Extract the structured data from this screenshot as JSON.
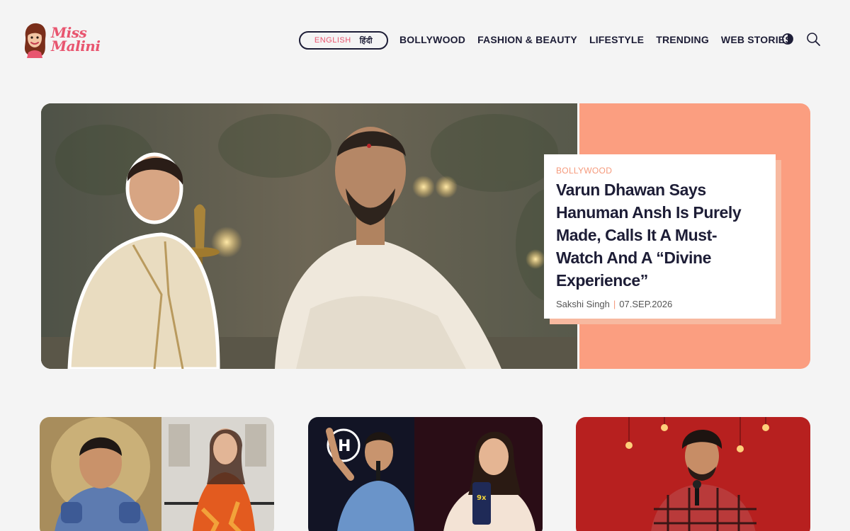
{
  "header": {
    "logo": {
      "line1": "Miss",
      "line2": "Malini"
    },
    "language": {
      "english": "ENGLISH",
      "hindi": "हिंदी"
    },
    "nav": [
      {
        "label": "BOLLYWOOD"
      },
      {
        "label": "FASHION & BEAUTY"
      },
      {
        "label": "LIFESTYLE"
      },
      {
        "label": "TRENDING"
      },
      {
        "label": "WEB STORIES"
      }
    ],
    "icons": {
      "theme": "contrast-icon",
      "search": "search-icon"
    }
  },
  "hero": {
    "category": "BOLLYWOOD",
    "title": "Varun Dhawan Says Hanuman Ansh Is Purely Made, Calls It A Must-Watch And A “Divine Experience”",
    "author": "Sakshi Singh",
    "separator": "|",
    "date": "07.SEP.2026"
  },
  "colors": {
    "accent": "#e8556f",
    "hero_panel": "#fb9e80",
    "category": "#f59a7c",
    "text": "#1d1d36",
    "background": "#f4f4f4"
  }
}
